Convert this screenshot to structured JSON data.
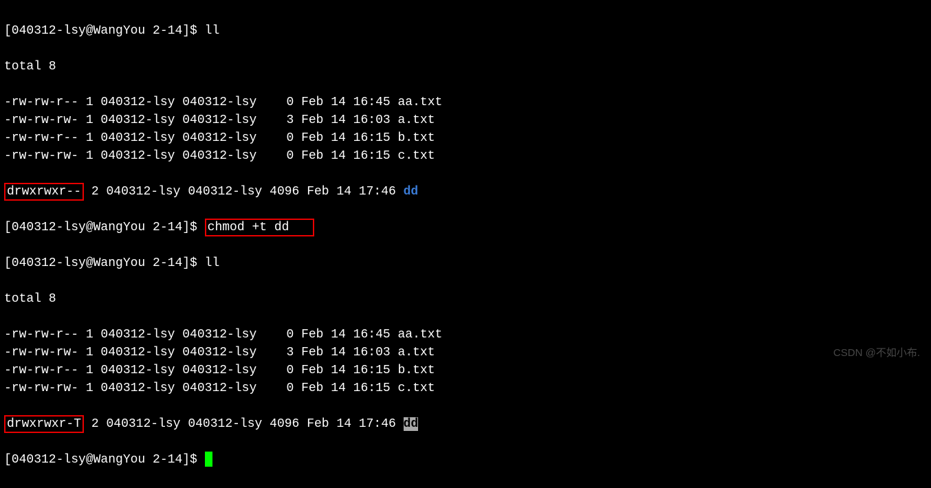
{
  "prompt": "[040312-lsy@WangYou 2-14]$ ",
  "cmd_ll": "ll",
  "cmd_chmod": "chmod +t dd",
  "total": "total 8",
  "rows1": [
    {
      "perm": "-rw-rw-r--",
      "links": "1",
      "user": "040312-lsy",
      "group": "040312-lsy",
      "size": "   0",
      "date": "Feb 14 16:45",
      "name": "aa.txt",
      "cls": ""
    },
    {
      "perm": "-rw-rw-rw-",
      "links": "1",
      "user": "040312-lsy",
      "group": "040312-lsy",
      "size": "   3",
      "date": "Feb 14 16:03",
      "name": "a.txt",
      "cls": ""
    },
    {
      "perm": "-rw-rw-r--",
      "links": "1",
      "user": "040312-lsy",
      "group": "040312-lsy",
      "size": "   0",
      "date": "Feb 14 16:15",
      "name": "b.txt",
      "cls": ""
    },
    {
      "perm": "-rw-rw-rw-",
      "links": "1",
      "user": "040312-lsy",
      "group": "040312-lsy",
      "size": "   0",
      "date": "Feb 14 16:15",
      "name": "c.txt",
      "cls": ""
    }
  ],
  "dir1": {
    "perm": "drwxrwxr--",
    "links": "2",
    "user": "040312-lsy",
    "group": "040312-lsy",
    "size": "4096",
    "date": "Feb 14 17:46",
    "name": "dd"
  },
  "rows2": [
    {
      "perm": "-rw-rw-r--",
      "links": "1",
      "user": "040312-lsy",
      "group": "040312-lsy",
      "size": "   0",
      "date": "Feb 14 16:45",
      "name": "aa.txt",
      "cls": ""
    },
    {
      "perm": "-rw-rw-rw-",
      "links": "1",
      "user": "040312-lsy",
      "group": "040312-lsy",
      "size": "   3",
      "date": "Feb 14 16:03",
      "name": "a.txt",
      "cls": ""
    },
    {
      "perm": "-rw-rw-r--",
      "links": "1",
      "user": "040312-lsy",
      "group": "040312-lsy",
      "size": "   0",
      "date": "Feb 14 16:15",
      "name": "b.txt",
      "cls": ""
    },
    {
      "perm": "-rw-rw-rw-",
      "links": "1",
      "user": "040312-lsy",
      "group": "040312-lsy",
      "size": "   0",
      "date": "Feb 14 16:15",
      "name": "c.txt",
      "cls": ""
    }
  ],
  "dir2": {
    "perm": "drwxrwxr-T",
    "links": "2",
    "user": "040312-lsy",
    "group": "040312-lsy",
    "size": "4096",
    "date": "Feb 14 17:46",
    "name": "dd"
  },
  "watermark": "CSDN @不如小布."
}
